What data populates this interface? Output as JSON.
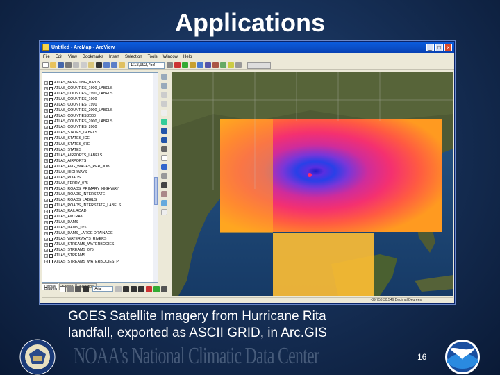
{
  "slide": {
    "title": "Applications",
    "caption_line1": "GOES Satellite Imagery from Hurricane Rita",
    "caption_line2": "landfall, exported as ASCII GRID, in Arc.GIS",
    "watermark": "NOAA's National Climatic Data Center",
    "page_number": "16"
  },
  "arcmap": {
    "window_title": "Untitled - ArcMap - ArcView",
    "window_buttons": [
      "_",
      "□",
      "×"
    ],
    "menu": [
      "File",
      "Edit",
      "View",
      "Bookmarks",
      "Insert",
      "Selection",
      "Tools",
      "Window",
      "Help"
    ],
    "scale_value": "1:12,992,758",
    "layers": [
      "ATLAS_BREEDING_BIRDS",
      "ATLAS_COUNTIES_1900_LABELS",
      "ATLAS_COUNTIES_1990_LABELS",
      "ATLAS_COUNTIES_1900",
      "ATLAS_COUNTIES_1990",
      "ATLAS_COUNTIES_2000_LABELS",
      "ATLAS_COUNTIES 2000",
      "ATLAS_COUNTIES_2000_LABELS",
      "ATLAS_COUNTIES_2000",
      "ATLAS_STATES_LABELS",
      "ATLAS_STATES_ICE",
      "ATLAS_STATES_67E",
      "ATLAS_STATES",
      "ATLAS_AIRPORTS_LABELS",
      "ATLAS_AIRPORTS",
      "ATLAS_AVG_WAGES_PER_JOB",
      "ATLAS_HIGHWAYS",
      "ATLAS_ROADS",
      "ATLAS_FERRY_075",
      "ATLAS_ROADS_PRIMARY_HIGHWAY",
      "ATLAS_ROADS_INTERSTATE",
      "ATLAS_ROADS_LABELS",
      "ATLAS_ROADS_INTERSTATE_LABELS",
      "ATLAS_RAILROAD",
      "ATLAS_AMTRAK",
      "ATLAS_DAMS",
      "ATLAS_DAMS_075",
      "ATLAS_DAMS_LARGE DRAINAGE",
      "ATLAS_WATERWAYS_RIVERS",
      "ATLAS_STREAMS_WATERBODIES",
      "ATLAS_STREAMS_075",
      "ATLAS_STREAMS",
      "ATLAS_STREAMS_WATERBODIES_P"
    ],
    "toc_tabs": [
      "Display",
      "Source",
      "Selection"
    ],
    "drawing_label": "Drawing",
    "font_name": "Arial",
    "status_text": "-89.753  30.546 Decimal Degrees"
  },
  "colors": {
    "background": "#173159",
    "titlebar": "#0842b4",
    "hurricane_eye": "#2a2ad8"
  }
}
